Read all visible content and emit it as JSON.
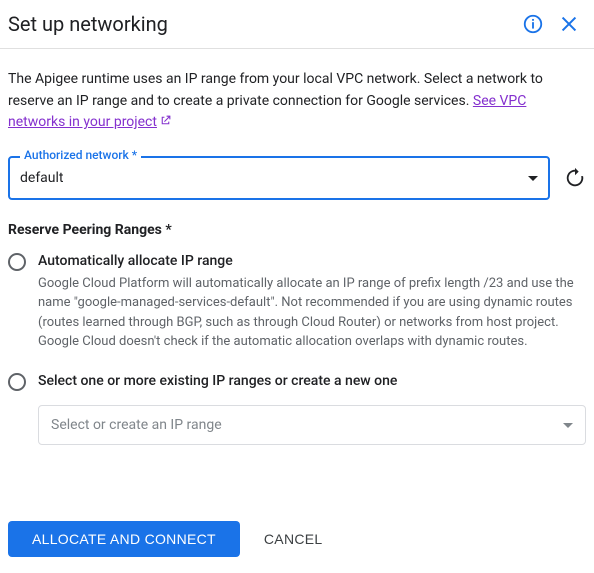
{
  "header": {
    "title": "Set up networking"
  },
  "description": {
    "text": "The Apigee runtime uses an IP range from your local VPC network. Select a network to reserve an IP range and to create a private connection for Google services. ",
    "link_text": "See VPC networks in your project"
  },
  "network_field": {
    "label": "Authorized network *",
    "value": "default"
  },
  "peering": {
    "title": "Reserve Peering Ranges *",
    "option_auto": {
      "label": "Automatically allocate IP range",
      "help": "Google Cloud Platform will automatically allocate an IP range of prefix length /23 and use the name \"google-managed-services-default\". Not recommended if you are using dynamic routes (routes learned through BGP, such as through Cloud Router) or networks from host project. Google Cloud doesn't check if the automatic allocation overlaps with dynamic routes."
    },
    "option_select": {
      "label": "Select one or more existing IP ranges or create a new one",
      "placeholder": "Select or create an IP range"
    }
  },
  "footer": {
    "primary": "ALLOCATE AND CONNECT",
    "cancel": "CANCEL"
  }
}
